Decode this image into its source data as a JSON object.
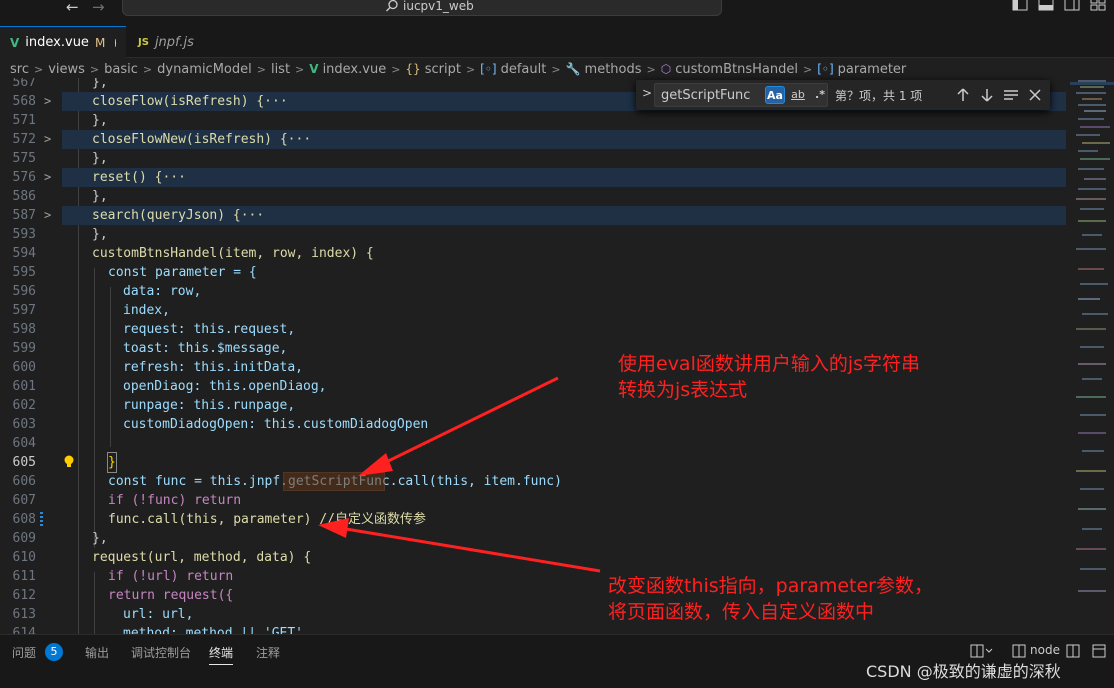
{
  "titlebar": {
    "search_text": "iucpv1_web"
  },
  "tabs": [
    {
      "label": "index.vue",
      "modified": "M"
    },
    {
      "label": "jnpf.js"
    }
  ],
  "breadcrumb": [
    "src",
    "views",
    "basic",
    "dynamicModel",
    "list",
    "index.vue",
    "script",
    "default",
    "methods",
    "customBtnsHandel",
    "parameter"
  ],
  "find": {
    "query": "getScriptFunc",
    "opt_case": "Aa",
    "opt_word": "ab",
    "opt_regex": ".*",
    "result": "第？项，共 1 项"
  },
  "editor": {
    "lines": [
      {
        "n": "567",
        "text": "},"
      },
      {
        "n": "568",
        "text": "closeFlow(isRefresh) {···"
      },
      {
        "n": "571",
        "text": "},"
      },
      {
        "n": "572",
        "text": "closeFlowNew(isRefresh) {···"
      },
      {
        "n": "575",
        "text": "},"
      },
      {
        "n": "576",
        "text": "reset() {···"
      },
      {
        "n": "586",
        "text": "},"
      },
      {
        "n": "587",
        "text": "search(queryJson) {···"
      },
      {
        "n": "593",
        "text": "},"
      },
      {
        "n": "594",
        "text": "customBtnsHandel(item, row, index) {"
      },
      {
        "n": "595",
        "text": "const parameter = {"
      },
      {
        "n": "596",
        "text": "data: row,"
      },
      {
        "n": "597",
        "text": "index,"
      },
      {
        "n": "598",
        "text": "request: this.request,"
      },
      {
        "n": "599",
        "text": "toast: this.$message,"
      },
      {
        "n": "600",
        "text": "refresh: this.initData,"
      },
      {
        "n": "601",
        "text": "openDiaog: this.openDiaog,"
      },
      {
        "n": "602",
        "text": "runpage: this.runpage,"
      },
      {
        "n": "603",
        "text": "customDiadogOpen: this.customDiadogOpen"
      },
      {
        "n": "604",
        "text": ""
      },
      {
        "n": "605",
        "text": "}"
      },
      {
        "n": "606",
        "text": "const func = this.jnpf.getScriptFunc.call(this, item.func)"
      },
      {
        "n": "607",
        "text": "if (!func) return"
      },
      {
        "n": "608",
        "text": "func.call(this, parameter) //自定义函数传参"
      },
      {
        "n": "609",
        "text": "},"
      },
      {
        "n": "610",
        "text": "request(url, method, data) {"
      },
      {
        "n": "611",
        "text": "if (!url) return"
      },
      {
        "n": "612",
        "text": "return request({"
      },
      {
        "n": "613",
        "text": "url: url,"
      },
      {
        "n": "614",
        "text": "method: method || 'GET',"
      }
    ]
  },
  "annotations": {
    "note1_line1": "使用eval函数讲用户输入的js字符串",
    "note1_line2": "转换为js表达式",
    "note2_line1": "改变函数this指向，parameter参数，",
    "note2_line2": "将页面函数，传入自定义函数中"
  },
  "panel": {
    "tabs": [
      "问题",
      "输出",
      "调试控制台",
      "终端",
      "注释"
    ],
    "problems_count": "5",
    "active_tab": "终端",
    "terminal_name": "node"
  },
  "watermark": "CSDN @极致的谦虚的深秋",
  "colors": {
    "accent": "#0078d4",
    "annotation": "#ff2020",
    "editor_bg": "#1f1f1f"
  }
}
